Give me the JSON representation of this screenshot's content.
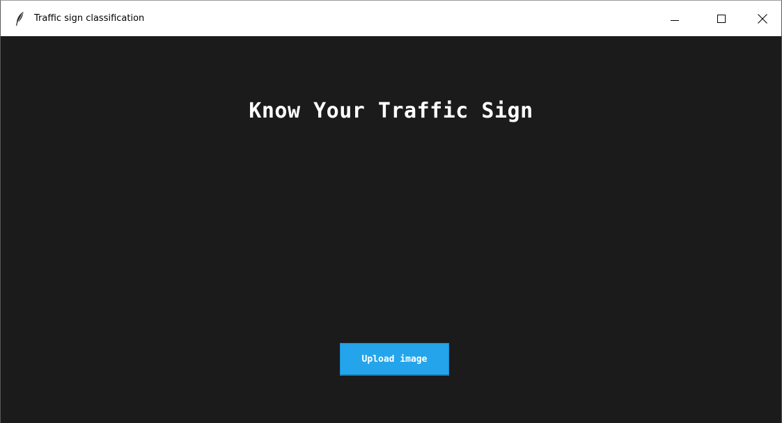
{
  "window": {
    "title": "Traffic sign classification",
    "app_icon": "feather-icon",
    "controls": {
      "minimize": "minimize-icon",
      "maximize": "maximize-icon",
      "close": "close-icon"
    }
  },
  "main": {
    "heading": "Know Your Traffic Sign",
    "upload_label": "Upload image"
  },
  "colors": {
    "background": "#1b1b1b",
    "heading_text": "#ffffff",
    "button_background": "#24a4eb",
    "button_text": "#ffffff"
  }
}
